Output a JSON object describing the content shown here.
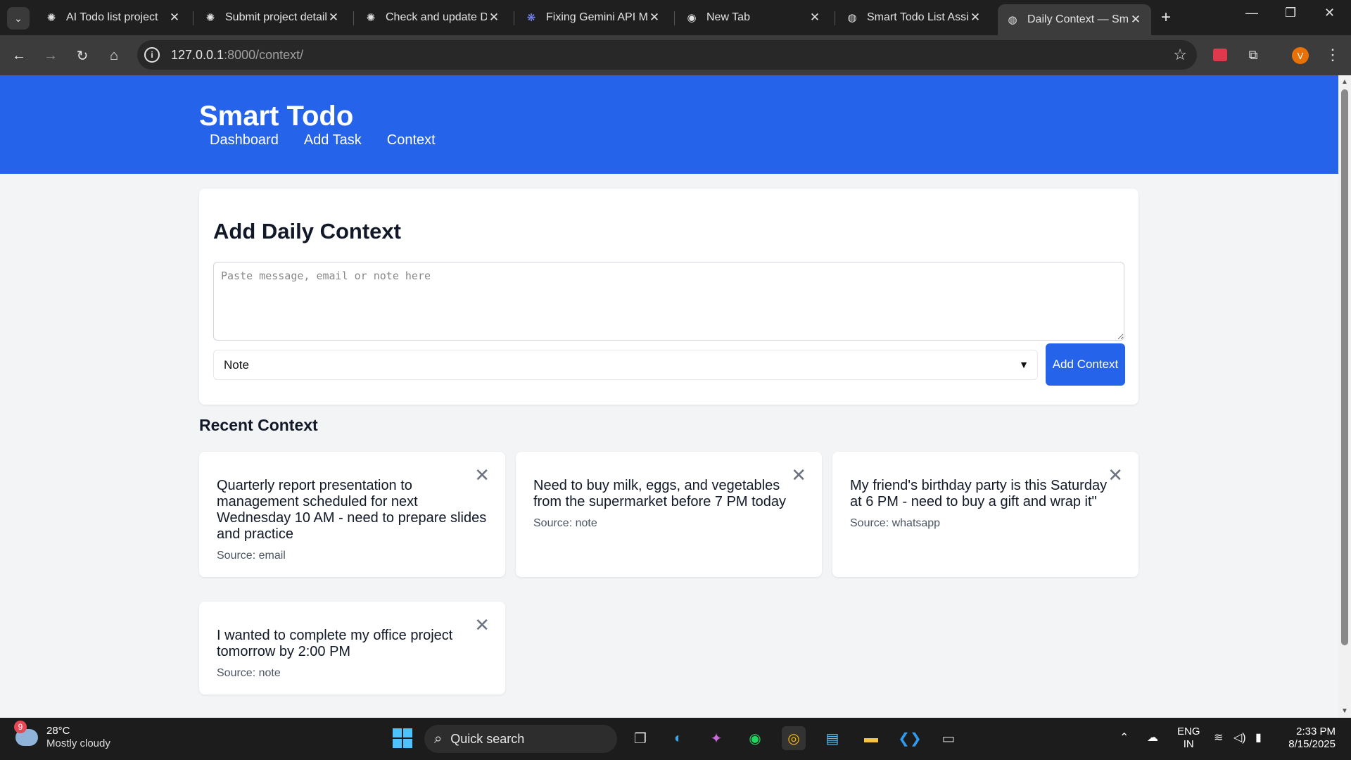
{
  "browser": {
    "tabs": [
      {
        "title": "AI Todo list project",
        "icon": "openai-icon"
      },
      {
        "title": "Submit project details",
        "icon": "openai-icon"
      },
      {
        "title": "Check and update Dj",
        "icon": "openai-icon"
      },
      {
        "title": "Fixing Gemini API Mo",
        "icon": "gemini-icon"
      },
      {
        "title": "New Tab",
        "icon": "chrome-icon"
      },
      {
        "title": "Smart Todo List Assis",
        "icon": "globe-icon"
      },
      {
        "title": "Daily Context — Sma",
        "icon": "globe-icon"
      }
    ],
    "url_host": "127.0.0.1",
    "url_rest": ":8000/context/",
    "profile_initial": "V"
  },
  "app": {
    "brand": "Smart Todo",
    "nav": [
      "Dashboard",
      "Add Task",
      "Context"
    ]
  },
  "form": {
    "title": "Add Daily Context",
    "textarea_placeholder": "Paste message, email or note here",
    "source_selected": "Note",
    "submit_label": "Add Context"
  },
  "recent": {
    "title": "Recent Context",
    "items": [
      {
        "message": "Quarterly report presentation to management scheduled for next Wednesday 10 AM - need to prepare slides and practice",
        "source": "Source: email"
      },
      {
        "message": "Need to buy milk, eggs, and vegetables from the supermarket before 7 PM today",
        "source": "Source: note"
      },
      {
        "message": "My friend's birthday party is this Saturday at 6 PM - need to buy a gift and wrap it\"",
        "source": "Source: whatsapp"
      },
      {
        "message": "I wanted to complete my office project tomorrow by 2:00 PM",
        "source": "Source: note"
      }
    ]
  },
  "taskbar": {
    "weather_badge": "9",
    "temperature": "28°C",
    "condition": "Mostly cloudy",
    "search_label": "Quick search",
    "lang_primary": "ENG",
    "lang_secondary": "IN",
    "time": "2:33 PM",
    "date": "8/15/2025"
  },
  "colors": {
    "primary": "#2563eb",
    "page_bg": "#f3f4f6"
  }
}
